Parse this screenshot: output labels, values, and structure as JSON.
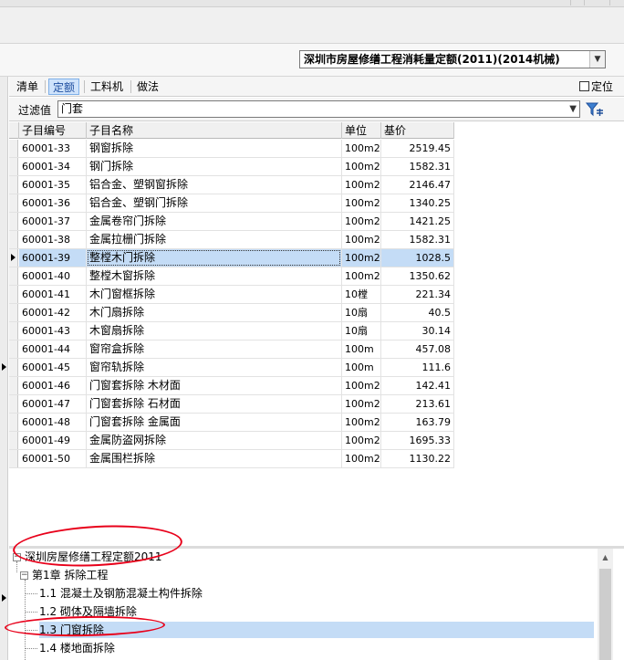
{
  "quota": {
    "selected": "深圳市房屋修缮工程消耗量定额(2011)(2014机械)"
  },
  "tabs": [
    {
      "label": "清单",
      "active": false
    },
    {
      "label": "定额",
      "active": true
    },
    {
      "label": "工料机",
      "active": false
    },
    {
      "label": "做法",
      "active": false
    }
  ],
  "locate": {
    "label": "定位",
    "checked": false
  },
  "filter": {
    "label": "过滤值",
    "value": "门套"
  },
  "grid": {
    "columns": [
      "子目编号",
      "子目名称",
      "单位",
      "基价"
    ],
    "selected_index": 6,
    "rows": [
      {
        "code": "60001-33",
        "name": "钢窗拆除",
        "unit": "100m2",
        "price": "2519.45"
      },
      {
        "code": "60001-34",
        "name": "钢门拆除",
        "unit": "100m2",
        "price": "1582.31"
      },
      {
        "code": "60001-35",
        "name": "铝合金、塑钢窗拆除",
        "unit": "100m2",
        "price": "2146.47"
      },
      {
        "code": "60001-36",
        "name": "铝合金、塑钢门拆除",
        "unit": "100m2",
        "price": "1340.25"
      },
      {
        "code": "60001-37",
        "name": "金属卷帘门拆除",
        "unit": "100m2",
        "price": "1421.25"
      },
      {
        "code": "60001-38",
        "name": "金属拉栅门拆除",
        "unit": "100m2",
        "price": "1582.31"
      },
      {
        "code": "60001-39",
        "name": "整樘木门拆除",
        "unit": "100m2",
        "price": "1028.5"
      },
      {
        "code": "60001-40",
        "name": "整樘木窗拆除",
        "unit": "100m2",
        "price": "1350.62"
      },
      {
        "code": "60001-41",
        "name": "木门窗框拆除",
        "unit": "10樘",
        "price": "221.34"
      },
      {
        "code": "60001-42",
        "name": "木门扇拆除",
        "unit": "10扇",
        "price": "40.5"
      },
      {
        "code": "60001-43",
        "name": "木窗扇拆除",
        "unit": "10扇",
        "price": "30.14"
      },
      {
        "code": "60001-44",
        "name": "窗帘盒拆除",
        "unit": "100m",
        "price": "457.08"
      },
      {
        "code": "60001-45",
        "name": "窗帘轨拆除",
        "unit": "100m",
        "price": "111.6"
      },
      {
        "code": "60001-46",
        "name": "门窗套拆除 木材面",
        "unit": "100m2",
        "price": "142.41"
      },
      {
        "code": "60001-47",
        "name": "门窗套拆除 石材面",
        "unit": "100m2",
        "price": "213.61"
      },
      {
        "code": "60001-48",
        "name": "门窗套拆除 金属面",
        "unit": "100m2",
        "price": "163.79"
      },
      {
        "code": "60001-49",
        "name": "金属防盗网拆除",
        "unit": "100m2",
        "price": "1695.33"
      },
      {
        "code": "60001-50",
        "name": "金属围栏拆除",
        "unit": "100m2",
        "price": "1130.22"
      }
    ]
  },
  "tree": {
    "root": "深圳房屋修缮工程定额2011",
    "chapter": "第1章  拆除工程",
    "items": [
      {
        "label": "1.1  混凝土及钢筋混凝土构件拆除",
        "selected": false
      },
      {
        "label": "1.2  砌体及隔墙拆除",
        "selected": false
      },
      {
        "label": "1.3  门窗拆除",
        "selected": true
      },
      {
        "label": "1.4  楼地面拆除",
        "selected": false
      }
    ]
  },
  "annotation_color": "#e8001a"
}
